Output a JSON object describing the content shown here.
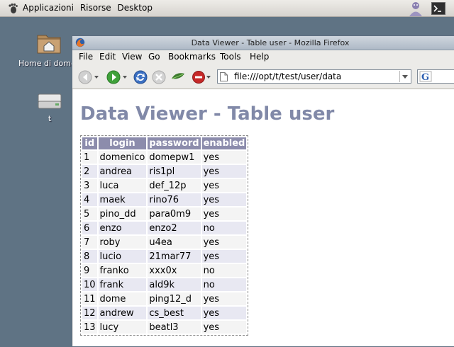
{
  "panel": {
    "menus": [
      "Applicazioni",
      "Risorse",
      "Desktop"
    ]
  },
  "desktop": {
    "icons": [
      {
        "label": "Home di domenico"
      },
      {
        "label": "t"
      }
    ]
  },
  "window": {
    "title": "Data Viewer - Table user - Mozilla Firefox",
    "menu": [
      "File",
      "Edit",
      "View",
      "Go",
      "Bookmarks",
      "Tools",
      "Help"
    ],
    "url": "file:///opt/t/test/user/data"
  },
  "page": {
    "heading": "Data Viewer - Table user",
    "columns": [
      "id",
      "login",
      "password",
      "enabled"
    ],
    "rows": [
      [
        "1",
        "domenico",
        "domepw1",
        "yes"
      ],
      [
        "2",
        "andrea",
        "ris1pl",
        "yes"
      ],
      [
        "3",
        "luca",
        "def_12p",
        "yes"
      ],
      [
        "4",
        "maek",
        "rino76",
        "yes"
      ],
      [
        "5",
        "pino_dd",
        "para0m9",
        "yes"
      ],
      [
        "6",
        "enzo",
        "enzo2",
        "no"
      ],
      [
        "7",
        "roby",
        "u4ea",
        "yes"
      ],
      [
        "8",
        "lucio",
        "21mar77",
        "yes"
      ],
      [
        "9",
        "franko",
        "xxx0x",
        "no"
      ],
      [
        "10",
        "frank",
        "ald9k",
        "no"
      ],
      [
        "11",
        "dome",
        "ping12_d",
        "yes"
      ],
      [
        "12",
        "andrew",
        "cs_best",
        "yes"
      ],
      [
        "13",
        "lucy",
        "beatl3",
        "yes"
      ]
    ]
  }
}
